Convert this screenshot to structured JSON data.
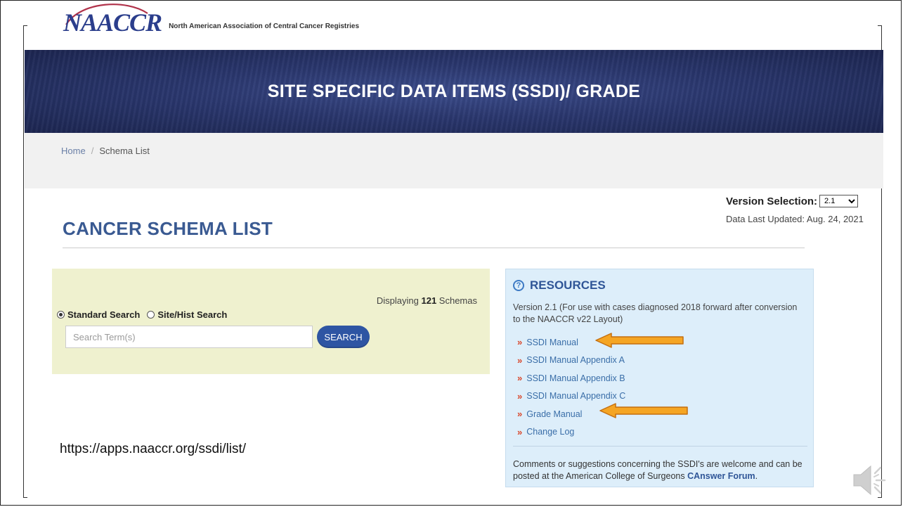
{
  "org": {
    "logo_text": "NAACCR",
    "full_name": "North American Association of Central Cancer Registries"
  },
  "banner": {
    "title": "SITE SPECIFIC DATA ITEMS (SSDI)/ GRADE"
  },
  "breadcrumb": {
    "home": "Home",
    "separator": "/",
    "current": "Schema List"
  },
  "version": {
    "label": "Version Selection:",
    "selected": "2.1",
    "last_updated": "Data Last Updated: Aug. 24, 2021"
  },
  "page": {
    "title": "CANCER SCHEMA LIST"
  },
  "search": {
    "display_prefix": "Displaying ",
    "display_count": "121",
    "display_suffix": " Schemas",
    "modes": [
      {
        "label": "Standard Search",
        "selected": true
      },
      {
        "label": "Site/Hist Search",
        "selected": false
      }
    ],
    "placeholder": "Search Term(s)",
    "button_label": "SEARCH"
  },
  "resources": {
    "heading": "RESOURCES",
    "description": "Version 2.1 (For use with cases diagnosed 2018 forward after conversion to the NAACCR v22 Layout)",
    "links": [
      {
        "label": "SSDI Manual",
        "highlighted": true
      },
      {
        "label": "SSDI Manual Appendix A",
        "highlighted": false
      },
      {
        "label": "SSDI Manual Appendix B",
        "highlighted": false
      },
      {
        "label": "SSDI Manual Appendix C",
        "highlighted": false
      },
      {
        "label": "Grade Manual",
        "highlighted": true
      },
      {
        "label": "Change Log",
        "highlighted": false
      }
    ],
    "footer_text": "Comments or suggestions concerning the SSDI's are welcome and can be posted at the American College of Surgeons ",
    "footer_link": "CAnswer Forum",
    "footer_end": "."
  },
  "slide": {
    "url_caption": "https://apps.naaccr.org/ssdi/list/"
  },
  "colors": {
    "brand_blue": "#2b3e8c",
    "title_blue": "#3a5a92",
    "link_blue": "#3a6ea8",
    "bullet_red": "#d9472b",
    "arrow_orange": "#f5a523",
    "search_panel_bg": "#eff1cf",
    "resources_bg": "#ddeefa"
  }
}
